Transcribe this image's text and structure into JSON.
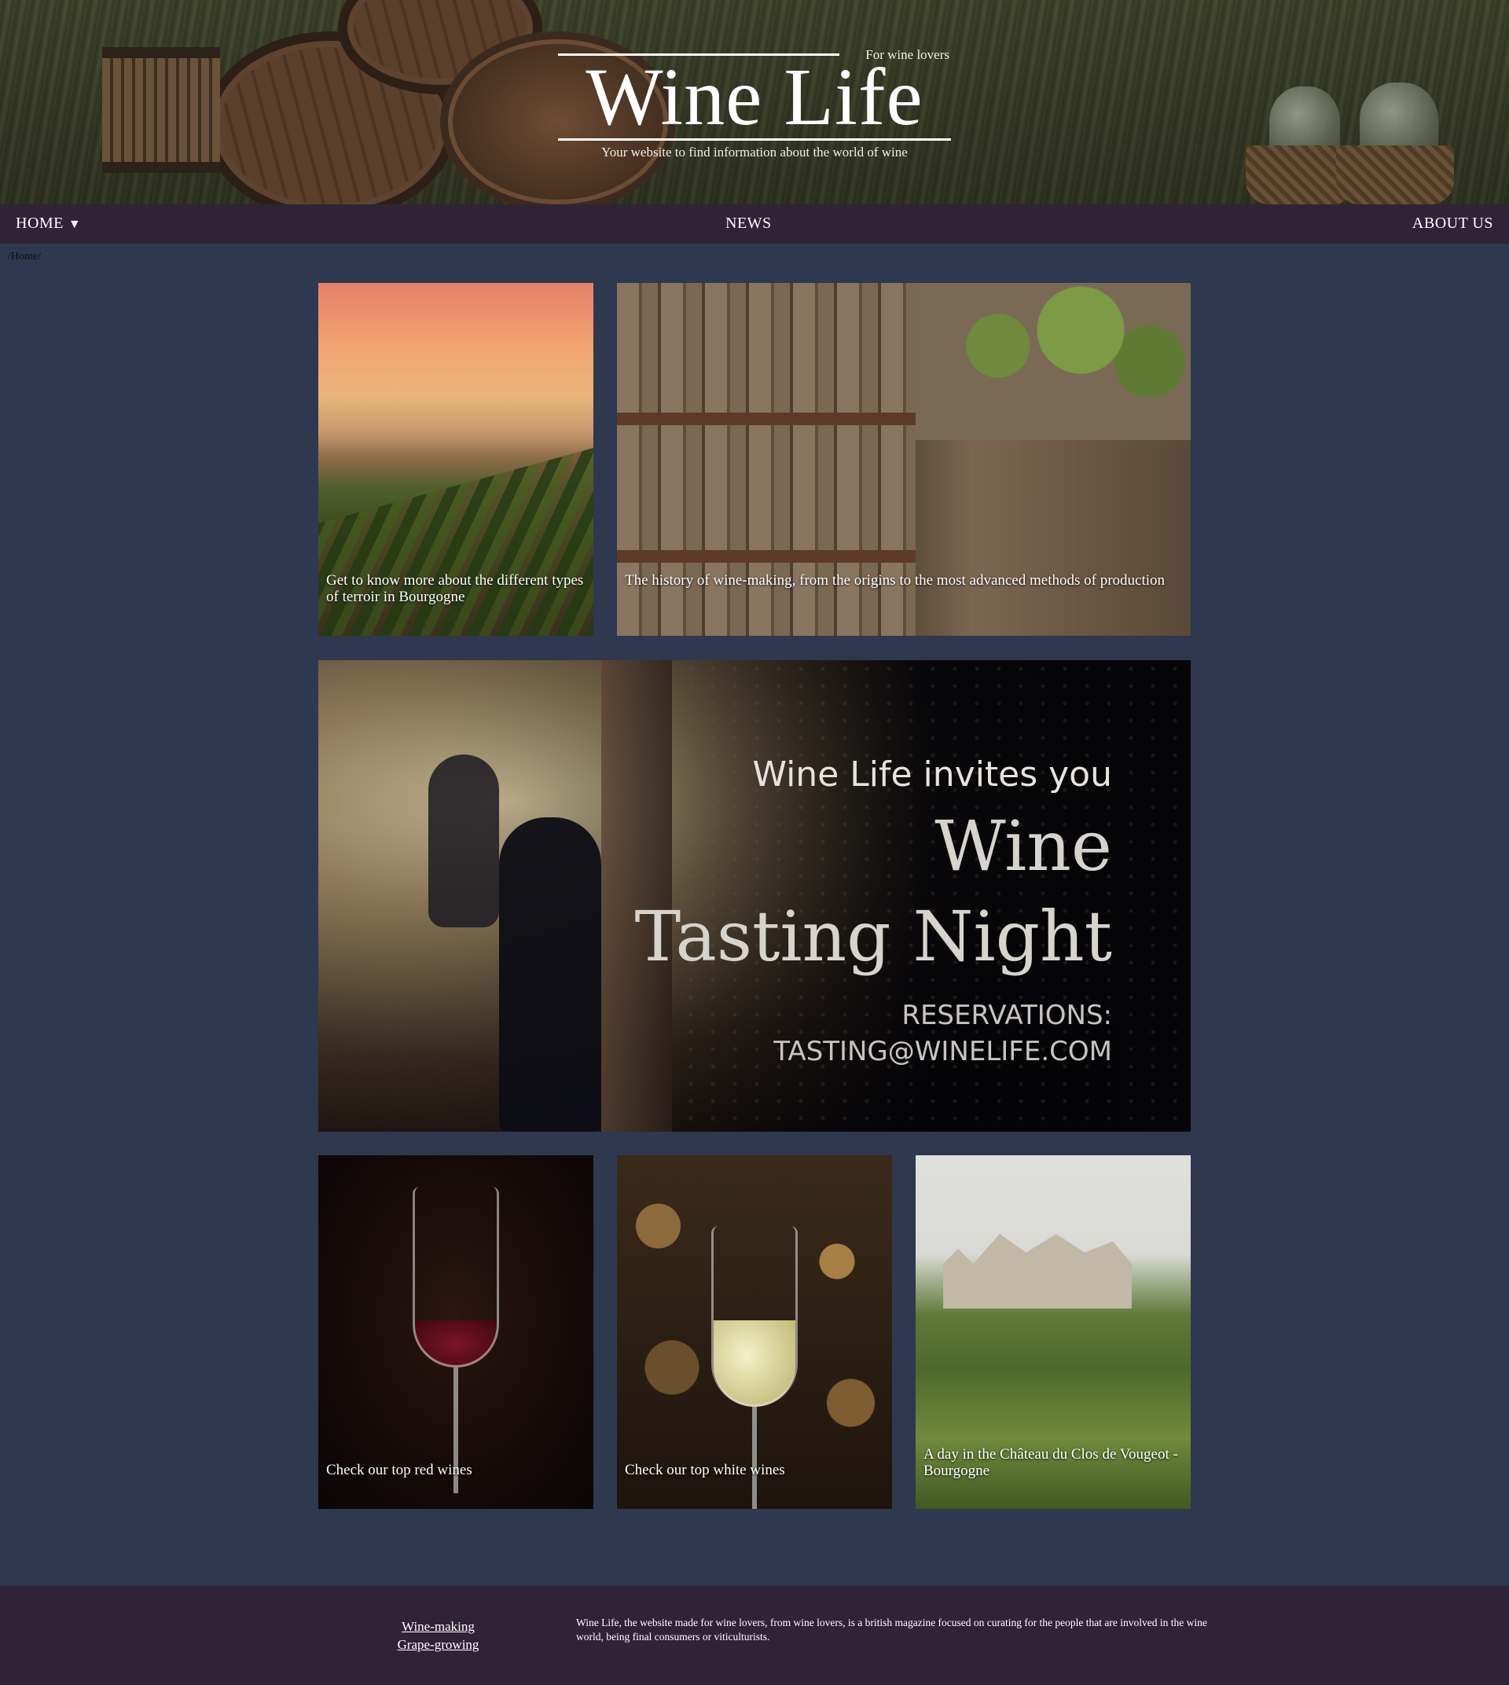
{
  "header": {
    "tagline_top": "For wine lovers",
    "title": "Wine Life",
    "subtitle": "Your website to find information about the world of wine"
  },
  "nav": {
    "home_label": "HOME",
    "home_caret": "▼",
    "news_label": "NEWS",
    "about_label": "ABOUT US"
  },
  "breadcrumb": "/Home/",
  "cards": {
    "terroir": {
      "caption": "Get to know more about the different types of terroir in Bourgogne"
    },
    "history": {
      "caption": "The history of wine-making, from the origins to the most advanced methods of production"
    },
    "red": {
      "caption": "Check our top red wines"
    },
    "white": {
      "caption": "Check our top white wines"
    },
    "chateau": {
      "caption": "A day in the Château du Clos de Vougeot - Bourgogne"
    }
  },
  "event": {
    "invite": "Wine Life invites you",
    "title_line1": "Wine",
    "title_line2": "Tasting Night",
    "reservations": "RESERVATIONS:",
    "email": "TASTING@WINELIFE.COM"
  },
  "footer": {
    "links": [
      "Wine-making",
      "Grape-growing"
    ],
    "about": "Wine Life, the website made for wine lovers, from wine lovers, is a british magazine focused on curating for the people that are involved in the wine world, being final consumers or viticulturists."
  },
  "colors": {
    "page_bg": "#2e384e",
    "nav_bg": "#302336",
    "footer_bg": "#302336",
    "text": "#ffffff"
  }
}
